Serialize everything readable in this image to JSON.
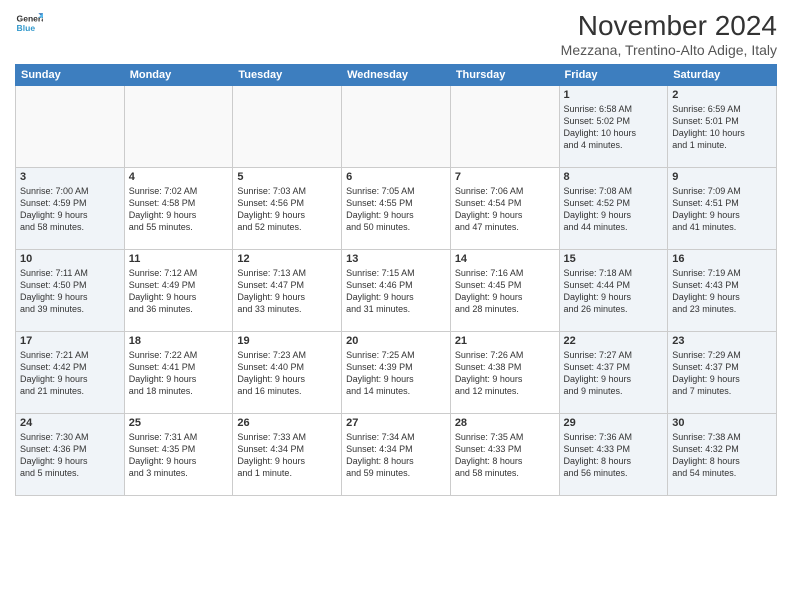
{
  "logo": {
    "line1": "General",
    "line2": "Blue"
  },
  "title": "November 2024",
  "subtitle": "Mezzana, Trentino-Alto Adige, Italy",
  "days_of_week": [
    "Sunday",
    "Monday",
    "Tuesday",
    "Wednesday",
    "Thursday",
    "Friday",
    "Saturday"
  ],
  "weeks": [
    [
      {
        "day": "",
        "info": "",
        "type": "empty"
      },
      {
        "day": "",
        "info": "",
        "type": "empty"
      },
      {
        "day": "",
        "info": "",
        "type": "empty"
      },
      {
        "day": "",
        "info": "",
        "type": "empty"
      },
      {
        "day": "",
        "info": "",
        "type": "empty"
      },
      {
        "day": "1",
        "info": "Sunrise: 6:58 AM\nSunset: 5:02 PM\nDaylight: 10 hours\nand 4 minutes.",
        "type": "weekend"
      },
      {
        "day": "2",
        "info": "Sunrise: 6:59 AM\nSunset: 5:01 PM\nDaylight: 10 hours\nand 1 minute.",
        "type": "weekend"
      }
    ],
    [
      {
        "day": "3",
        "info": "Sunrise: 7:00 AM\nSunset: 4:59 PM\nDaylight: 9 hours\nand 58 minutes.",
        "type": "weekend"
      },
      {
        "day": "4",
        "info": "Sunrise: 7:02 AM\nSunset: 4:58 PM\nDaylight: 9 hours\nand 55 minutes.",
        "type": "weekday"
      },
      {
        "day": "5",
        "info": "Sunrise: 7:03 AM\nSunset: 4:56 PM\nDaylight: 9 hours\nand 52 minutes.",
        "type": "weekday"
      },
      {
        "day": "6",
        "info": "Sunrise: 7:05 AM\nSunset: 4:55 PM\nDaylight: 9 hours\nand 50 minutes.",
        "type": "weekday"
      },
      {
        "day": "7",
        "info": "Sunrise: 7:06 AM\nSunset: 4:54 PM\nDaylight: 9 hours\nand 47 minutes.",
        "type": "weekday"
      },
      {
        "day": "8",
        "info": "Sunrise: 7:08 AM\nSunset: 4:52 PM\nDaylight: 9 hours\nand 44 minutes.",
        "type": "weekend"
      },
      {
        "day": "9",
        "info": "Sunrise: 7:09 AM\nSunset: 4:51 PM\nDaylight: 9 hours\nand 41 minutes.",
        "type": "weekend"
      }
    ],
    [
      {
        "day": "10",
        "info": "Sunrise: 7:11 AM\nSunset: 4:50 PM\nDaylight: 9 hours\nand 39 minutes.",
        "type": "weekend"
      },
      {
        "day": "11",
        "info": "Sunrise: 7:12 AM\nSunset: 4:49 PM\nDaylight: 9 hours\nand 36 minutes.",
        "type": "weekday"
      },
      {
        "day": "12",
        "info": "Sunrise: 7:13 AM\nSunset: 4:47 PM\nDaylight: 9 hours\nand 33 minutes.",
        "type": "weekday"
      },
      {
        "day": "13",
        "info": "Sunrise: 7:15 AM\nSunset: 4:46 PM\nDaylight: 9 hours\nand 31 minutes.",
        "type": "weekday"
      },
      {
        "day": "14",
        "info": "Sunrise: 7:16 AM\nSunset: 4:45 PM\nDaylight: 9 hours\nand 28 minutes.",
        "type": "weekday"
      },
      {
        "day": "15",
        "info": "Sunrise: 7:18 AM\nSunset: 4:44 PM\nDaylight: 9 hours\nand 26 minutes.",
        "type": "weekend"
      },
      {
        "day": "16",
        "info": "Sunrise: 7:19 AM\nSunset: 4:43 PM\nDaylight: 9 hours\nand 23 minutes.",
        "type": "weekend"
      }
    ],
    [
      {
        "day": "17",
        "info": "Sunrise: 7:21 AM\nSunset: 4:42 PM\nDaylight: 9 hours\nand 21 minutes.",
        "type": "weekend"
      },
      {
        "day": "18",
        "info": "Sunrise: 7:22 AM\nSunset: 4:41 PM\nDaylight: 9 hours\nand 18 minutes.",
        "type": "weekday"
      },
      {
        "day": "19",
        "info": "Sunrise: 7:23 AM\nSunset: 4:40 PM\nDaylight: 9 hours\nand 16 minutes.",
        "type": "weekday"
      },
      {
        "day": "20",
        "info": "Sunrise: 7:25 AM\nSunset: 4:39 PM\nDaylight: 9 hours\nand 14 minutes.",
        "type": "weekday"
      },
      {
        "day": "21",
        "info": "Sunrise: 7:26 AM\nSunset: 4:38 PM\nDaylight: 9 hours\nand 12 minutes.",
        "type": "weekday"
      },
      {
        "day": "22",
        "info": "Sunrise: 7:27 AM\nSunset: 4:37 PM\nDaylight: 9 hours\nand 9 minutes.",
        "type": "weekend"
      },
      {
        "day": "23",
        "info": "Sunrise: 7:29 AM\nSunset: 4:37 PM\nDaylight: 9 hours\nand 7 minutes.",
        "type": "weekend"
      }
    ],
    [
      {
        "day": "24",
        "info": "Sunrise: 7:30 AM\nSunset: 4:36 PM\nDaylight: 9 hours\nand 5 minutes.",
        "type": "weekend"
      },
      {
        "day": "25",
        "info": "Sunrise: 7:31 AM\nSunset: 4:35 PM\nDaylight: 9 hours\nand 3 minutes.",
        "type": "weekday"
      },
      {
        "day": "26",
        "info": "Sunrise: 7:33 AM\nSunset: 4:34 PM\nDaylight: 9 hours\nand 1 minute.",
        "type": "weekday"
      },
      {
        "day": "27",
        "info": "Sunrise: 7:34 AM\nSunset: 4:34 PM\nDaylight: 8 hours\nand 59 minutes.",
        "type": "weekday"
      },
      {
        "day": "28",
        "info": "Sunrise: 7:35 AM\nSunset: 4:33 PM\nDaylight: 8 hours\nand 58 minutes.",
        "type": "weekday"
      },
      {
        "day": "29",
        "info": "Sunrise: 7:36 AM\nSunset: 4:33 PM\nDaylight: 8 hours\nand 56 minutes.",
        "type": "weekend"
      },
      {
        "day": "30",
        "info": "Sunrise: 7:38 AM\nSunset: 4:32 PM\nDaylight: 8 hours\nand 54 minutes.",
        "type": "weekend"
      }
    ]
  ]
}
